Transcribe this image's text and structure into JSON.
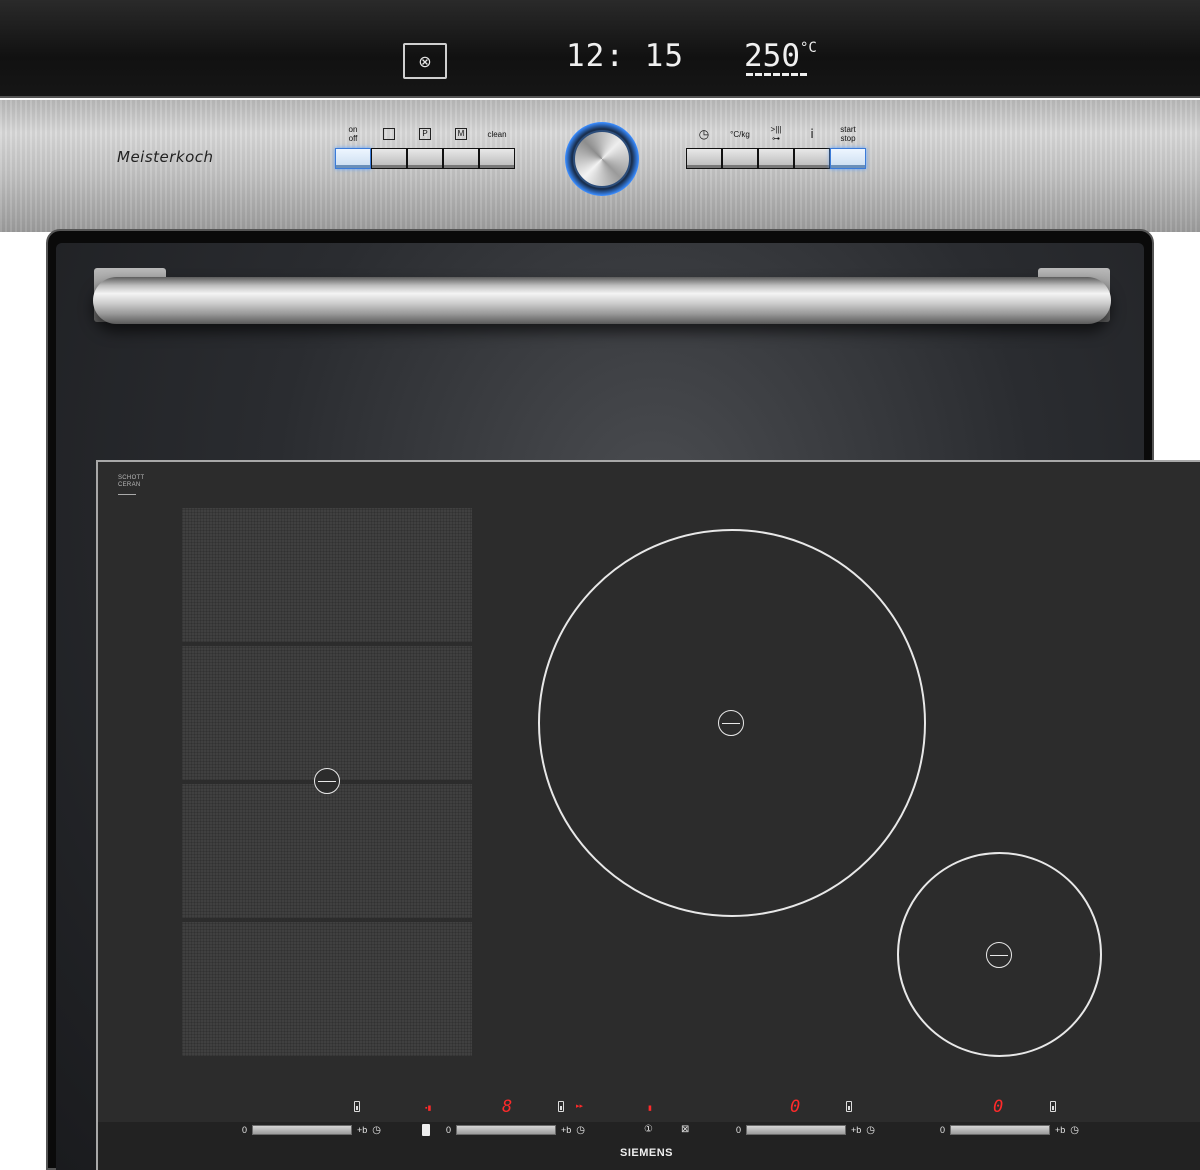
{
  "oven": {
    "display": {
      "mode_icon": "fan-icon",
      "mode_glyph": "⊗",
      "time": "12: 15",
      "temperature": "250",
      "temperature_unit": "°C"
    },
    "brand": "Meisterkoch",
    "left_buttons": [
      {
        "label": "on\noff",
        "icon": "power-icon"
      },
      {
        "label": "",
        "icon": "square-mode-icon",
        "glyph": "□"
      },
      {
        "label": "",
        "icon": "programme-icon",
        "glyph": "P"
      },
      {
        "label": "",
        "icon": "meat-probe-icon",
        "glyph": "M"
      },
      {
        "label": "clean",
        "icon": "clean-icon"
      }
    ],
    "right_buttons": [
      {
        "label": "",
        "icon": "clock-icon",
        "glyph": "◷"
      },
      {
        "label": "°C/kg",
        "icon": "temperature-weight-icon"
      },
      {
        "label": ">|||\n⊶",
        "icon": "rapid-heat-lock-icon"
      },
      {
        "label": "i",
        "icon": "info-icon"
      },
      {
        "label": "start\nstop",
        "icon": "start-stop-icon"
      }
    ],
    "accent_color": "#3a8cff"
  },
  "hob": {
    "glass_brand": "SCHOTT\nCERAN",
    "bottom_brand": "SIEMENS",
    "red_digits": [
      "8",
      "0",
      "0"
    ],
    "slider_zero": "0",
    "slider_plus": "+b",
    "timer_glyph": "◷",
    "info_glyph": "ⓘ",
    "power_glyph": "①",
    "accent_color": "#ff2a2a"
  }
}
